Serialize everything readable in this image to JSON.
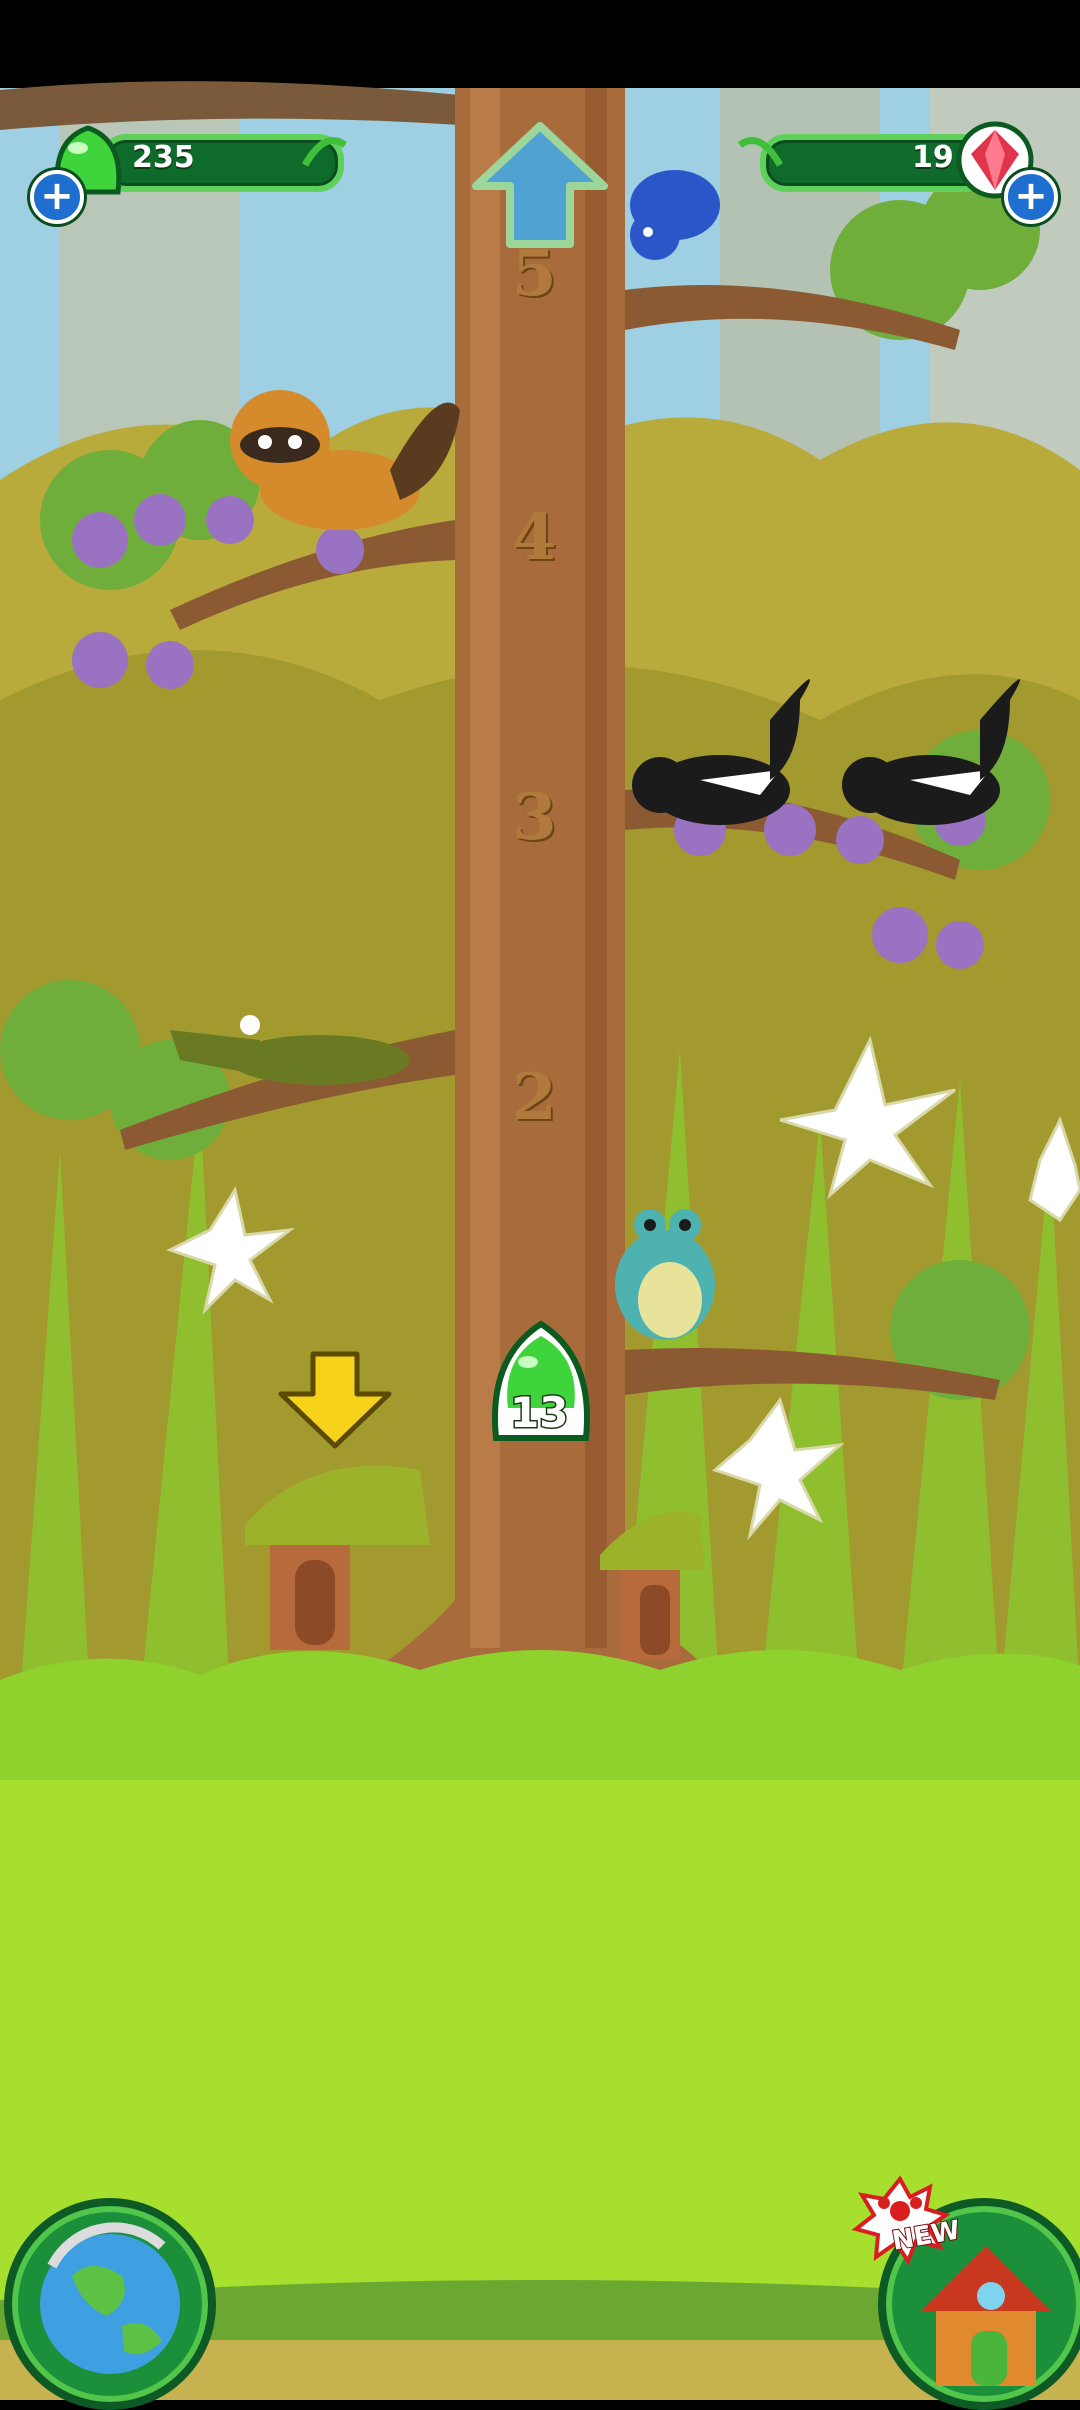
{
  "hud": {
    "jelly_count": "235",
    "gem_count": "19",
    "jelly_add_icon": "plus-icon",
    "gem_add_icon": "plus-icon"
  },
  "tree": {
    "floors": [
      "5",
      "4",
      "3",
      "2"
    ],
    "up_arrow_icon": "up-arrow-icon"
  },
  "reward": {
    "jelly_amount": "13"
  },
  "bottom_nav": {
    "map_icon": "globe-icon",
    "shop_icon": "house-icon",
    "new_badge": "NEW"
  },
  "colors": {
    "accent_green": "#5fd15a",
    "hud_dark": "#0f6b2c",
    "grass": "#a6df2e",
    "sky": "#9ecfe3",
    "plus_blue": "#1f6fd1"
  }
}
